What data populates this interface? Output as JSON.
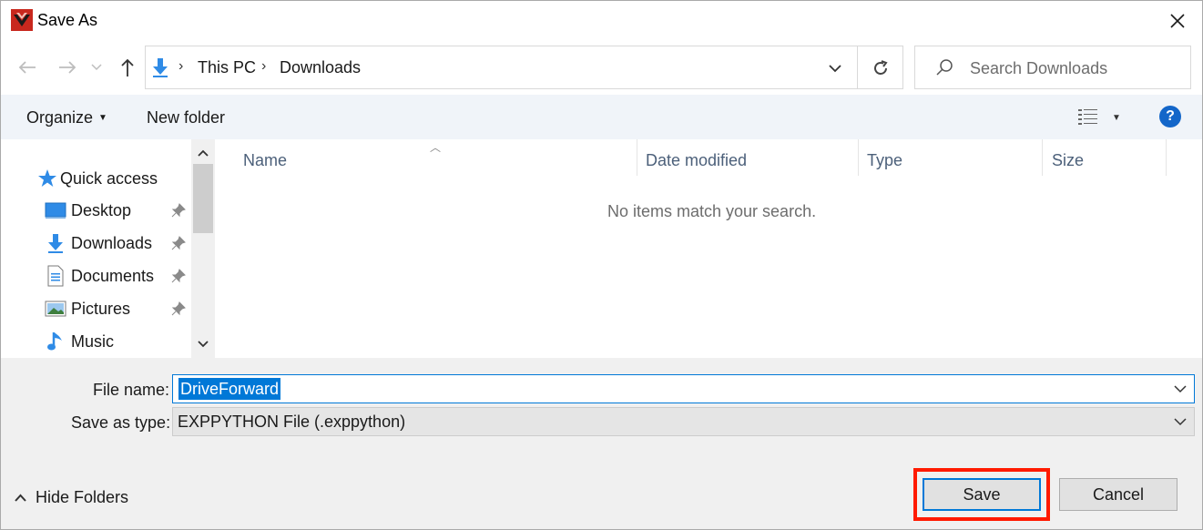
{
  "window": {
    "title": "Save As"
  },
  "address": {
    "crumbs": [
      "This PC",
      "Downloads"
    ],
    "search_placeholder": "Search Downloads"
  },
  "toolbar": {
    "organize_label": "Organize",
    "new_folder_label": "New folder"
  },
  "nav": {
    "items": [
      {
        "label": "Quick access",
        "icon": "star-icon",
        "pinned": false
      },
      {
        "label": "Desktop",
        "icon": "desktop-icon",
        "pinned": true
      },
      {
        "label": "Downloads",
        "icon": "download-arrow-icon",
        "pinned": true
      },
      {
        "label": "Documents",
        "icon": "document-icon",
        "pinned": true
      },
      {
        "label": "Pictures",
        "icon": "picture-icon",
        "pinned": true
      },
      {
        "label": "Music",
        "icon": "music-note-icon",
        "pinned": false
      }
    ]
  },
  "files": {
    "columns": [
      "Name",
      "Date modified",
      "Type",
      "Size"
    ],
    "empty_message": "No items match your search."
  },
  "form": {
    "file_name_label": "File name:",
    "file_name_value": "DriveForward",
    "save_type_label": "Save as type:",
    "save_type_value": "EXPPYTHON File (.exppython)"
  },
  "footer": {
    "hide_folders_label": "Hide Folders",
    "save_label": "Save",
    "cancel_label": "Cancel"
  },
  "colors": {
    "accent": "#0078d7",
    "highlight": "#ff1a00",
    "help": "#1366c9"
  }
}
